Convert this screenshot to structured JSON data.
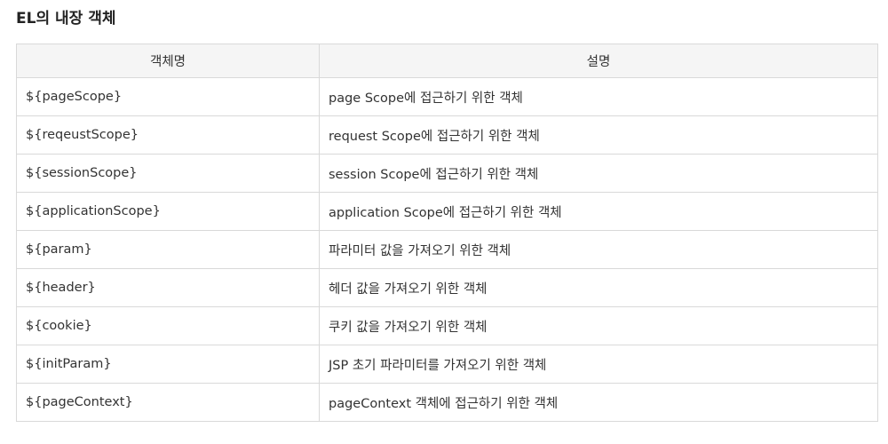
{
  "title": "EL의 내장 객체",
  "table": {
    "headers": [
      "객체명",
      "설명"
    ],
    "rows": [
      {
        "name": "${pageScope}",
        "desc": "page Scope에 접근하기 위한 객체"
      },
      {
        "name": "${reqeustScope}",
        "desc": "request Scope에 접근하기 위한 객체"
      },
      {
        "name": "${sessionScope}",
        "desc": "session Scope에 접근하기 위한 객체"
      },
      {
        "name": "${applicationScope}",
        "desc": "application Scope에 접근하기 위한 객체"
      },
      {
        "name": "${param}",
        "desc": "파라미터 값을 가져오기 위한 객체"
      },
      {
        "name": "${header}",
        "desc": "헤더 값을 가져오기 위한 객체"
      },
      {
        "name": "${cookie}",
        "desc": "쿠키 값을 가져오기 위한 객체"
      },
      {
        "name": "${initParam}",
        "desc": "JSP 초기 파라미터를 가져오기 위한 객체"
      },
      {
        "name": "${pageContext}",
        "desc": "pageContext 객체에 접근하기 위한 객체"
      }
    ]
  }
}
